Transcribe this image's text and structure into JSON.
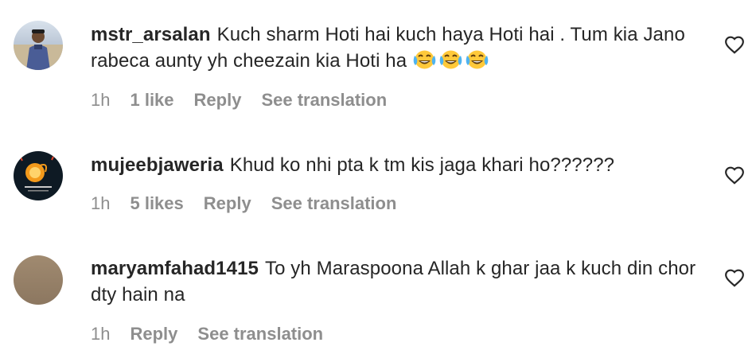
{
  "comments": [
    {
      "username": "mstr_arsalan",
      "text": "Kuch sharm Hoti hai kuch haya Hoti hai . Tum kia Jano rabeca aunty yh cheezain kia Hoti ha",
      "emojis": [
        "face-with-tears-of-joy",
        "face-with-tears-of-joy",
        "face-with-tears-of-joy"
      ],
      "time": "1h",
      "likes": "1 like",
      "reply": "Reply",
      "translate": "See translation",
      "avatar_colors": [
        "#b8c5d6",
        "#6a7ea8",
        "#2f3e6a"
      ]
    },
    {
      "username": "mujeebjaweria",
      "text": "Khud ko nhi pta k tm kis jaga khari ho??????",
      "time": "1h",
      "likes": "5 likes",
      "reply": "Reply",
      "translate": "See translation",
      "avatar_colors": [
        "#0e1a24",
        "#f39a1b",
        "#ffd36b"
      ]
    },
    {
      "username": "maryamfahad1415",
      "text": "To yh Maraspoona Allah k ghar jaa k kuch din chor dty hain na",
      "time": "1h",
      "reply": "Reply",
      "translate": "See translation",
      "avatar_colors": [
        "#a58e72",
        "#8c7760"
      ]
    }
  ],
  "colors": {
    "text": "#262626",
    "meta": "#8e8e8e",
    "background": "#ffffff"
  },
  "icons": {
    "like": "heart-outline-icon"
  }
}
